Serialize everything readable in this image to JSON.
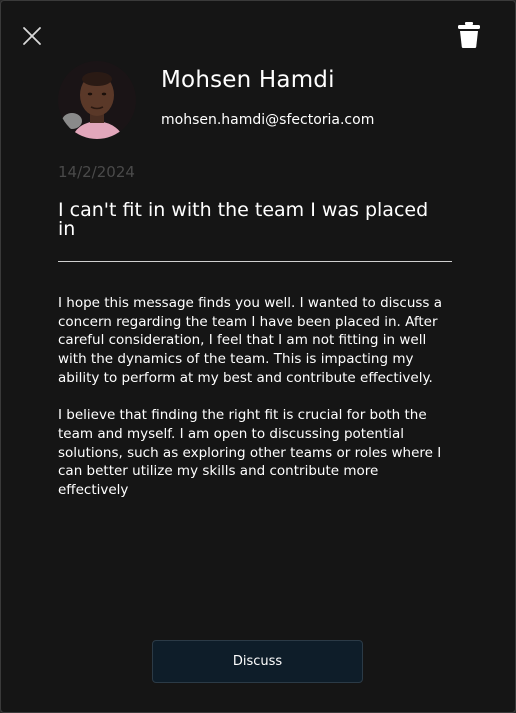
{
  "sender": {
    "name": "Mohsen Hamdi",
    "email": "mohsen.hamdi@sfectoria.com"
  },
  "message": {
    "date": "14/2/2024",
    "subject": "I can't fit in with the team I was placed in",
    "paragraphs": [
      "I hope this message finds you well. I wanted to discuss a concern regarding the team I have been placed in. After careful consideration, I feel that I am not fitting in well with the dynamics of the team. This is impacting my ability to perform at my best and contribute effectively.",
      "I believe that finding the right fit is crucial for both the team and myself. I am open to discussing potential solutions, such as exploring other teams or roles where I can better utilize my skills and contribute more effectively"
    ]
  },
  "actions": {
    "discuss_label": "Discuss"
  },
  "icons": {
    "close": "close-icon",
    "delete": "trash-icon"
  },
  "colors": {
    "background": "#151515",
    "button": "#0e1d29",
    "date": "#4a4a4a",
    "text": "#ffffff"
  }
}
